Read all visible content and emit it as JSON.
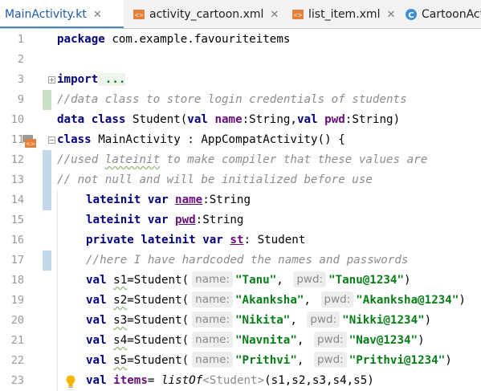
{
  "tabs": [
    {
      "label": "MainActivity.kt",
      "icon": "kotlin-file-icon",
      "active": true,
      "closable": true
    },
    {
      "label": "activity_cartoon.xml",
      "icon": "xml-file-icon",
      "active": false,
      "closable": true
    },
    {
      "label": "list_item.xml",
      "icon": "xml-file-icon",
      "active": false,
      "closable": true
    },
    {
      "label": "CartoonAct",
      "icon": "kotlin-class-icon",
      "active": false,
      "closable": false
    }
  ],
  "close_glyph": "✕",
  "editor": {
    "line_numbers": [
      "1",
      "2",
      "3",
      "9",
      "10",
      "11",
      "12",
      "13",
      "14",
      "15",
      "16",
      "17",
      "18",
      "19",
      "20",
      "21",
      "22",
      "23"
    ],
    "lines": {
      "l1": {
        "kw": "package",
        "rest": " com.example.favouriteitems"
      },
      "l3": {
        "kw": "import",
        "rest": " ..."
      },
      "l9": {
        "comment": "//data class to store login credentials of students"
      },
      "l10": {
        "kw": "data class",
        "a": " Student(",
        "kw2": "val",
        "p1": " name",
        "b": ":String,",
        "kw3": "val",
        "p2": " pwd",
        "c": ":String)"
      },
      "l11": {
        "kw": "class",
        "rest": " MainActivity : AppCompatActivity() {"
      },
      "l12": {
        "c1": "//used ",
        "c2": "lateinit",
        "c3": " to make compiler that these values are"
      },
      "l13": {
        "comment": "// not null and will be initialized before use"
      },
      "l14": {
        "kw": "lateinit var",
        "p": "name",
        "t": ":String"
      },
      "l15": {
        "kw": "lateinit var",
        "p": "pwd",
        "t": ":String"
      },
      "l16": {
        "kw": "private lateinit var",
        "p": "st",
        "t": ": Student"
      },
      "l17": {
        "comment": "//here I have hardcoded the names and passwords"
      },
      "l18": {
        "v": "s1",
        "name": "\"Tanu\"",
        "pwd": "\"Tanu@1234\""
      },
      "l19": {
        "v": "s2",
        "name": "\"Akanksha\"",
        "pwd": "\"Akanksha@1234\""
      },
      "l20": {
        "v": "s3",
        "name": "\"Nikita\"",
        "pwd": "\"Nikki@1234\""
      },
      "l21": {
        "v": "s4",
        "name": "\"Navnita\"",
        "pwd": "\"Nav@1234\""
      },
      "l22": {
        "v": "s5",
        "name": "\"Prithvi\"",
        "pwd": "\"Prithvi@1234\""
      },
      "l23": {
        "v": "items",
        "eq": "= ",
        "fn": "listOf",
        "gen": "<Student>",
        "args": "(s1,s2,s3,s4,s5)"
      }
    },
    "tokens": {
      "val": "val",
      "ctor": "=Student(",
      "hint_name": "name:",
      "hint_pwd": "pwd:",
      "comma": ", ",
      "close": ")"
    }
  },
  "colors": {
    "keyword": "#000080",
    "string": "#067d17",
    "comment": "#8c8c8c",
    "property": "#660e7a",
    "active_tab_underline": "#4a88c7"
  }
}
